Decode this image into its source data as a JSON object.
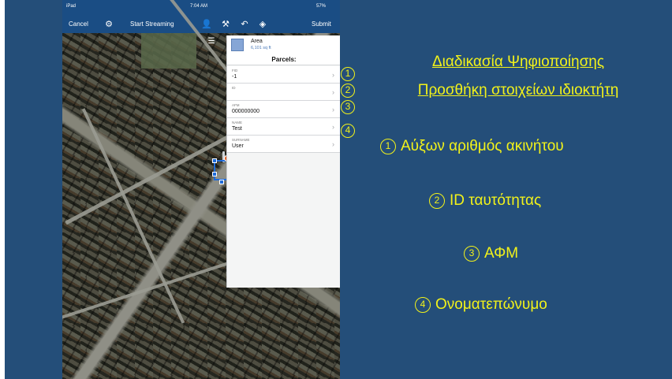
{
  "status_bar": {
    "device": "iPad",
    "time": "7:04 AM",
    "battery": "57%"
  },
  "navbar": {
    "cancel_label": "Cancel",
    "start_streaming_label": "Start Streaming",
    "submit_label": "Submit",
    "icons": [
      "gear-icon",
      "add-user-icon",
      "tools-icon",
      "undo-icon",
      "eraser-icon"
    ]
  },
  "panel": {
    "layer_name": "Area",
    "layer_size": "6,101 sq ft",
    "title": "Parcels:",
    "fields": [
      {
        "label": "FID",
        "value": "-1"
      },
      {
        "label": "Id",
        "value": ""
      },
      {
        "label": "AFM",
        "value": "000000000"
      },
      {
        "label": "NAME",
        "value": "Test"
      },
      {
        "label": "SURNAME",
        "value": "User"
      }
    ]
  },
  "field_badges": [
    "1",
    "2",
    "3",
    "4"
  ],
  "slide": {
    "heading_line1": "Διαδικασία Ψηφιοποίησης",
    "heading_line2": "Προσθήκη στοιχείων ιδιοκτήτη",
    "items": [
      {
        "num": "1",
        "text": "Αύξων αριθμός ακινήτου"
      },
      {
        "num": "2",
        "text": "ID ταυτότητας"
      },
      {
        "num": "3",
        "text": "ΑΦΜ"
      },
      {
        "num": "4",
        "text": "Ονοματεπώνυμο"
      }
    ]
  },
  "colors": {
    "slide_bg": "#244e79",
    "accent_yellow": "#f2f21a",
    "ios_blue": "#1a4d84"
  }
}
